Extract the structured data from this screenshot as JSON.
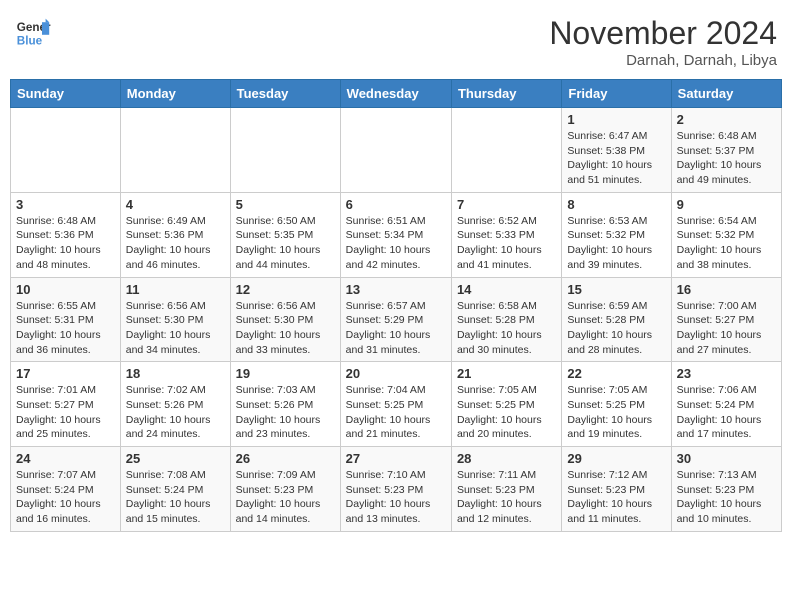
{
  "header": {
    "logo_line1": "General",
    "logo_line2": "Blue",
    "month_title": "November 2024",
    "location": "Darnah, Darnah, Libya"
  },
  "weekdays": [
    "Sunday",
    "Monday",
    "Tuesday",
    "Wednesday",
    "Thursday",
    "Friday",
    "Saturday"
  ],
  "weeks": [
    [
      {
        "day": "",
        "info": ""
      },
      {
        "day": "",
        "info": ""
      },
      {
        "day": "",
        "info": ""
      },
      {
        "day": "",
        "info": ""
      },
      {
        "day": "",
        "info": ""
      },
      {
        "day": "1",
        "info": "Sunrise: 6:47 AM\nSunset: 5:38 PM\nDaylight: 10 hours and 51 minutes."
      },
      {
        "day": "2",
        "info": "Sunrise: 6:48 AM\nSunset: 5:37 PM\nDaylight: 10 hours and 49 minutes."
      }
    ],
    [
      {
        "day": "3",
        "info": "Sunrise: 6:48 AM\nSunset: 5:36 PM\nDaylight: 10 hours and 48 minutes."
      },
      {
        "day": "4",
        "info": "Sunrise: 6:49 AM\nSunset: 5:36 PM\nDaylight: 10 hours and 46 minutes."
      },
      {
        "day": "5",
        "info": "Sunrise: 6:50 AM\nSunset: 5:35 PM\nDaylight: 10 hours and 44 minutes."
      },
      {
        "day": "6",
        "info": "Sunrise: 6:51 AM\nSunset: 5:34 PM\nDaylight: 10 hours and 42 minutes."
      },
      {
        "day": "7",
        "info": "Sunrise: 6:52 AM\nSunset: 5:33 PM\nDaylight: 10 hours and 41 minutes."
      },
      {
        "day": "8",
        "info": "Sunrise: 6:53 AM\nSunset: 5:32 PM\nDaylight: 10 hours and 39 minutes."
      },
      {
        "day": "9",
        "info": "Sunrise: 6:54 AM\nSunset: 5:32 PM\nDaylight: 10 hours and 38 minutes."
      }
    ],
    [
      {
        "day": "10",
        "info": "Sunrise: 6:55 AM\nSunset: 5:31 PM\nDaylight: 10 hours and 36 minutes."
      },
      {
        "day": "11",
        "info": "Sunrise: 6:56 AM\nSunset: 5:30 PM\nDaylight: 10 hours and 34 minutes."
      },
      {
        "day": "12",
        "info": "Sunrise: 6:56 AM\nSunset: 5:30 PM\nDaylight: 10 hours and 33 minutes."
      },
      {
        "day": "13",
        "info": "Sunrise: 6:57 AM\nSunset: 5:29 PM\nDaylight: 10 hours and 31 minutes."
      },
      {
        "day": "14",
        "info": "Sunrise: 6:58 AM\nSunset: 5:28 PM\nDaylight: 10 hours and 30 minutes."
      },
      {
        "day": "15",
        "info": "Sunrise: 6:59 AM\nSunset: 5:28 PM\nDaylight: 10 hours and 28 minutes."
      },
      {
        "day": "16",
        "info": "Sunrise: 7:00 AM\nSunset: 5:27 PM\nDaylight: 10 hours and 27 minutes."
      }
    ],
    [
      {
        "day": "17",
        "info": "Sunrise: 7:01 AM\nSunset: 5:27 PM\nDaylight: 10 hours and 25 minutes."
      },
      {
        "day": "18",
        "info": "Sunrise: 7:02 AM\nSunset: 5:26 PM\nDaylight: 10 hours and 24 minutes."
      },
      {
        "day": "19",
        "info": "Sunrise: 7:03 AM\nSunset: 5:26 PM\nDaylight: 10 hours and 23 minutes."
      },
      {
        "day": "20",
        "info": "Sunrise: 7:04 AM\nSunset: 5:25 PM\nDaylight: 10 hours and 21 minutes."
      },
      {
        "day": "21",
        "info": "Sunrise: 7:05 AM\nSunset: 5:25 PM\nDaylight: 10 hours and 20 minutes."
      },
      {
        "day": "22",
        "info": "Sunrise: 7:05 AM\nSunset: 5:25 PM\nDaylight: 10 hours and 19 minutes."
      },
      {
        "day": "23",
        "info": "Sunrise: 7:06 AM\nSunset: 5:24 PM\nDaylight: 10 hours and 17 minutes."
      }
    ],
    [
      {
        "day": "24",
        "info": "Sunrise: 7:07 AM\nSunset: 5:24 PM\nDaylight: 10 hours and 16 minutes."
      },
      {
        "day": "25",
        "info": "Sunrise: 7:08 AM\nSunset: 5:24 PM\nDaylight: 10 hours and 15 minutes."
      },
      {
        "day": "26",
        "info": "Sunrise: 7:09 AM\nSunset: 5:23 PM\nDaylight: 10 hours and 14 minutes."
      },
      {
        "day": "27",
        "info": "Sunrise: 7:10 AM\nSunset: 5:23 PM\nDaylight: 10 hours and 13 minutes."
      },
      {
        "day": "28",
        "info": "Sunrise: 7:11 AM\nSunset: 5:23 PM\nDaylight: 10 hours and 12 minutes."
      },
      {
        "day": "29",
        "info": "Sunrise: 7:12 AM\nSunset: 5:23 PM\nDaylight: 10 hours and 11 minutes."
      },
      {
        "day": "30",
        "info": "Sunrise: 7:13 AM\nSunset: 5:23 PM\nDaylight: 10 hours and 10 minutes."
      }
    ]
  ]
}
